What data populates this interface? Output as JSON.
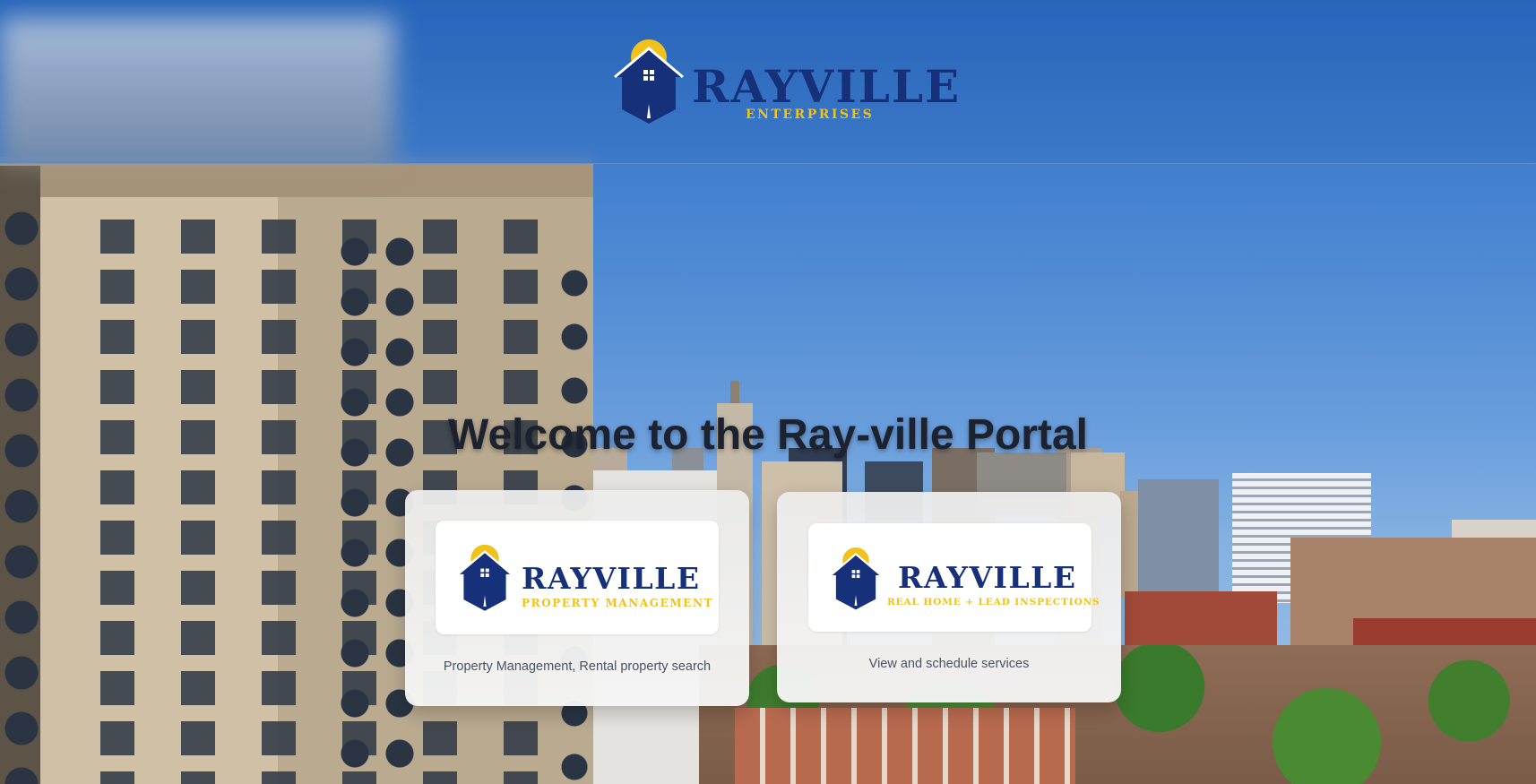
{
  "header": {
    "brand_title": "RAYVILLE",
    "brand_subtitle": "ENTERPRISES"
  },
  "welcome": {
    "heading": "Welcome to the Ray-ville Portal"
  },
  "portals": [
    {
      "logo_title": "RAYVILLE",
      "logo_subtitle": "PROPERTY MANAGEMENT",
      "description": "Property Management, Rental property search"
    },
    {
      "logo_title": "RAYVILLE",
      "logo_subtitle": "REAL HOME + LEAD INSPECTIONS",
      "description": "View and schedule services"
    }
  ],
  "colors": {
    "brand_navy": "#16307a",
    "brand_yellow": "#f1c21b",
    "header_blue": "#2f6dbd"
  },
  "icons": {
    "logo": "house-with-sun-icon"
  }
}
